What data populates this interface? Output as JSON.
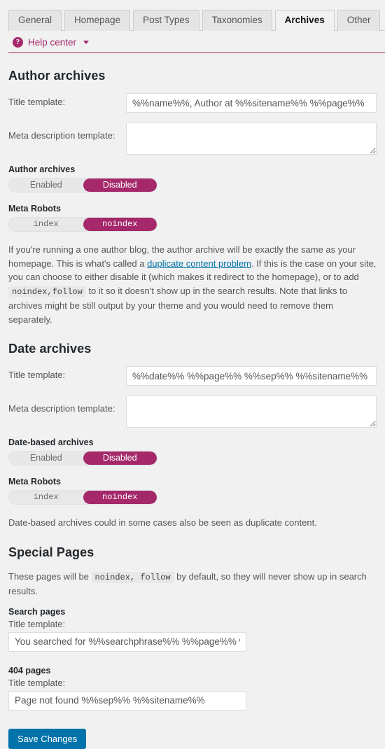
{
  "tabs": [
    {
      "label": "General",
      "active": false
    },
    {
      "label": "Homepage",
      "active": false
    },
    {
      "label": "Post Types",
      "active": false
    },
    {
      "label": "Taxonomies",
      "active": false
    },
    {
      "label": "Archives",
      "active": true
    },
    {
      "label": "Other",
      "active": false
    }
  ],
  "help": {
    "icon": "question-mark-circle-icon",
    "label": "Help center",
    "caret": "chevron-down-icon"
  },
  "author": {
    "heading": "Author archives",
    "title_label": "Title template:",
    "title_value": "%%name%%, Author at %%sitename%% %%page%%",
    "meta_label": "Meta description template:",
    "meta_value": "",
    "toggle_heading": "Author archives",
    "toggle_off": "Enabled",
    "toggle_on": "Disabled",
    "toggle_selected": "Disabled",
    "robots_heading": "Meta Robots",
    "robots_off": "index",
    "robots_on": "noindex",
    "robots_selected": "noindex",
    "desc_part1": "If you're running a one author blog, the author archive will be exactly the same as your homepage. This is what's called a ",
    "desc_link": "duplicate content problem",
    "desc_part2": ". If this is the case on your site, you can choose to either disable it (which makes it redirect to the homepage), or to add ",
    "desc_code": "noindex,follow",
    "desc_part3": " to it so it doesn't show up in the search results. Note that links to archives might be still output by your theme and you would need to remove them separately."
  },
  "date": {
    "heading": "Date archives",
    "title_label": "Title template:",
    "title_value": "%%date%% %%page%% %%sep%% %%sitename%%",
    "meta_label": "Meta description template:",
    "meta_value": "",
    "toggle_heading": "Date-based archives",
    "toggle_off": "Enabled",
    "toggle_on": "Disabled",
    "toggle_selected": "Disabled",
    "robots_heading": "Meta Robots",
    "robots_off": "index",
    "robots_on": "noindex",
    "robots_selected": "noindex",
    "desc": "Date-based archives could in some cases also be seen as duplicate content."
  },
  "special": {
    "heading": "Special Pages",
    "desc_part1": "These pages will be ",
    "desc_code": "noindex, follow",
    "desc_part2": " by default, so they will never show up in search results.",
    "search_heading": "Search pages",
    "search_title_label": "Title template:",
    "search_title_value": "You searched for %%searchphrase%% %%page%% %%sep%%",
    "notfound_heading": "404 pages",
    "notfound_title_label": "Title template:",
    "notfound_title_value": "Page not found %%sep%% %%sitename%%"
  },
  "save_label": "Save Changes",
  "colors": {
    "accent_magenta": "#a4286a",
    "link_blue": "#0073aa",
    "page_bg": "#f1f1f1"
  }
}
